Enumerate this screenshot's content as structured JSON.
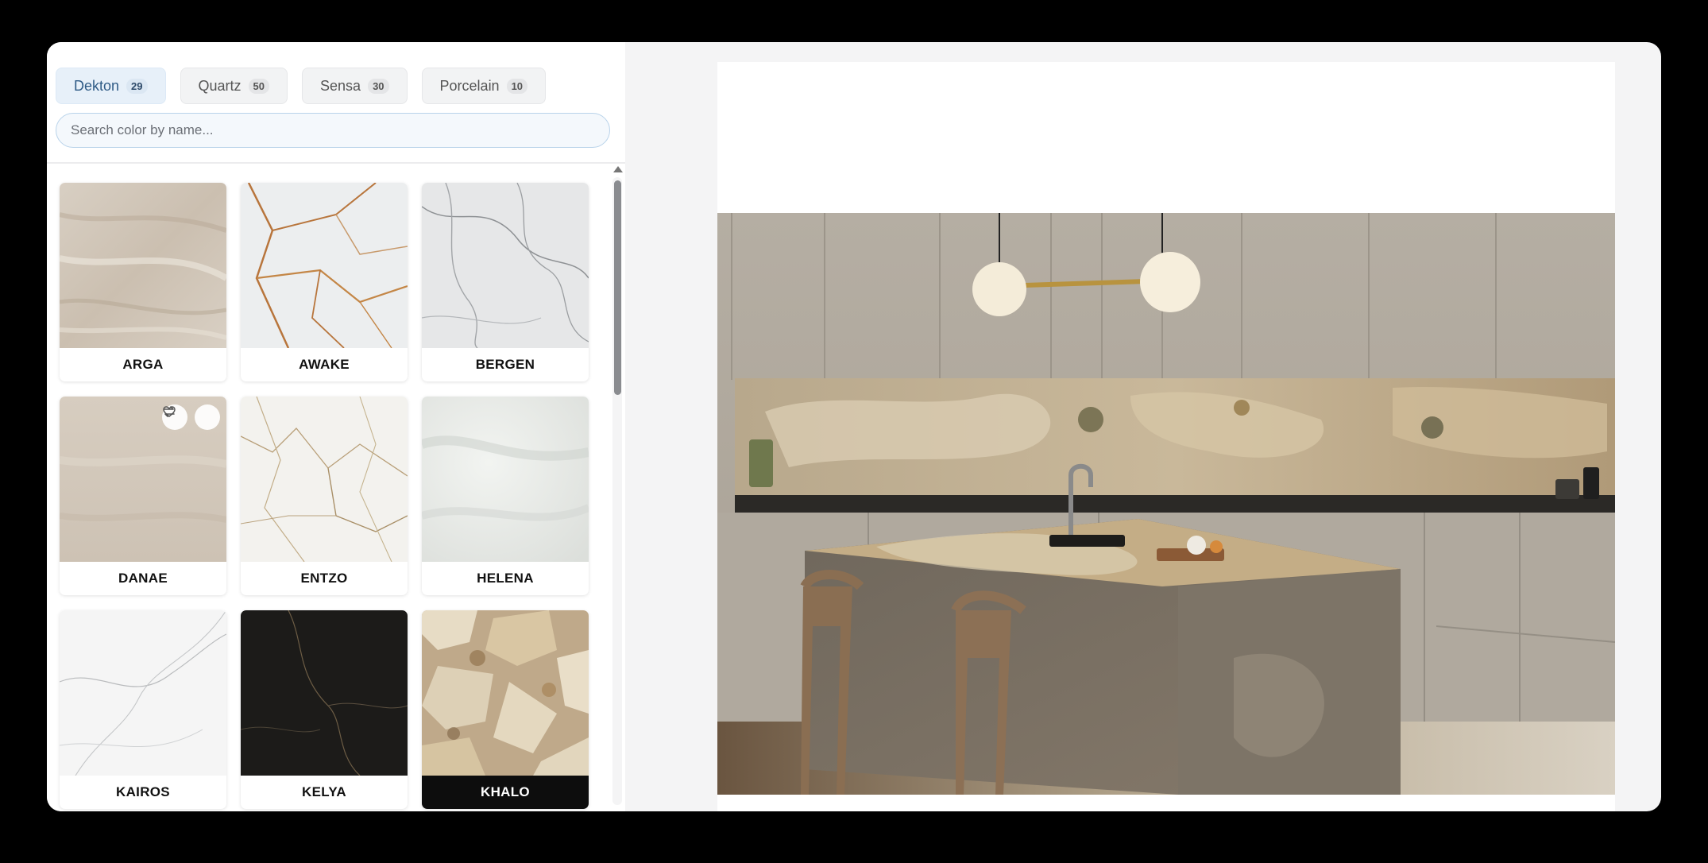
{
  "tabs": [
    {
      "label": "Dekton",
      "count": "29",
      "active": true
    },
    {
      "label": "Quartz",
      "count": "50"
    },
    {
      "label": "Sensa",
      "count": "30"
    },
    {
      "label": "Porcelain",
      "count": "10"
    }
  ],
  "search": {
    "placeholder": "Search color by name..."
  },
  "colors": [
    {
      "name": "ARGA",
      "texture": "beige-vein"
    },
    {
      "name": "AWAKE",
      "texture": "white-gold-vein"
    },
    {
      "name": "BERGEN",
      "texture": "grey-marble"
    },
    {
      "name": "DANAE",
      "texture": "taupe-plain"
    },
    {
      "name": "ENTZO",
      "texture": "white-fine-vein"
    },
    {
      "name": "HELENA",
      "texture": "soft-grey"
    },
    {
      "name": "KAIROS",
      "texture": "white-light-vein"
    },
    {
      "name": "KELYA",
      "texture": "black-vein"
    },
    {
      "name": "KHALO",
      "texture": "gold-patchwork",
      "selected": true
    }
  ],
  "card_actions": {
    "swap_icon": "swap-icon",
    "favorite_icon": "heart-icon"
  },
  "preview": {
    "image": "kitchen-island-render"
  },
  "theme": {
    "accent": "#2f5b86",
    "selected_label_bg": "#0d0d0d"
  }
}
